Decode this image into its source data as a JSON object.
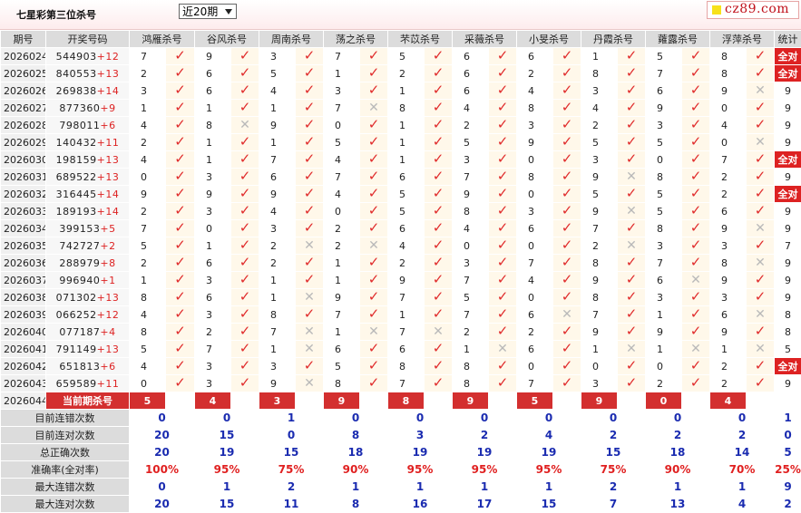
{
  "title": "七星彩第三位杀号",
  "select": "近20期",
  "logo": "cz89.com",
  "colors": {
    "accent": "#d32f2f",
    "check": "#e02b2b",
    "blue": "#1a2bb0"
  },
  "headers": [
    "期号",
    "开奖号码",
    "鸿雁杀号",
    "谷风杀号",
    "周南杀号",
    "荡之杀号",
    "芣苡杀号",
    "采薇杀号",
    "小旻杀号",
    "丹霞杀号",
    "蕹露杀号",
    "浮萍杀号",
    "统计"
  ],
  "rows": [
    {
      "p": "2026024",
      "n": "544903",
      "s": "+12",
      "k": [
        [
          "7",
          1
        ],
        [
          "9",
          1
        ],
        [
          "3",
          1
        ],
        [
          "7",
          1
        ],
        [
          "5",
          1
        ],
        [
          "6",
          1
        ],
        [
          "6",
          1
        ],
        [
          "1",
          1
        ],
        [
          "5",
          1
        ],
        [
          "8",
          1
        ]
      ],
      "t": "全对"
    },
    {
      "p": "2026025",
      "n": "840553",
      "s": "+13",
      "k": [
        [
          "2",
          1
        ],
        [
          "6",
          1
        ],
        [
          "5",
          1
        ],
        [
          "1",
          1
        ],
        [
          "2",
          1
        ],
        [
          "6",
          1
        ],
        [
          "2",
          1
        ],
        [
          "8",
          1
        ],
        [
          "7",
          1
        ],
        [
          "8",
          1
        ]
      ],
      "t": "全对"
    },
    {
      "p": "2026026",
      "n": "269838",
      "s": "+14",
      "k": [
        [
          "3",
          1
        ],
        [
          "6",
          1
        ],
        [
          "4",
          1
        ],
        [
          "3",
          1
        ],
        [
          "1",
          1
        ],
        [
          "6",
          1
        ],
        [
          "4",
          1
        ],
        [
          "3",
          1
        ],
        [
          "6",
          1
        ],
        [
          "9",
          0
        ]
      ],
      "t": "9"
    },
    {
      "p": "2026027",
      "n": "877360",
      "s": "+9",
      "k": [
        [
          "1",
          1
        ],
        [
          "1",
          1
        ],
        [
          "1",
          1
        ],
        [
          "7",
          0
        ],
        [
          "8",
          1
        ],
        [
          "4",
          1
        ],
        [
          "8",
          1
        ],
        [
          "4",
          1
        ],
        [
          "9",
          1
        ],
        [
          "0",
          1
        ]
      ],
      "t": "9"
    },
    {
      "p": "2026028",
      "n": "798011",
      "s": "+6",
      "k": [
        [
          "4",
          1
        ],
        [
          "8",
          0
        ],
        [
          "9",
          1
        ],
        [
          "0",
          1
        ],
        [
          "1",
          1
        ],
        [
          "2",
          1
        ],
        [
          "3",
          1
        ],
        [
          "2",
          1
        ],
        [
          "3",
          1
        ],
        [
          "4",
          1
        ]
      ],
      "t": "9"
    },
    {
      "p": "2026029",
      "n": "140432",
      "s": "+11",
      "k": [
        [
          "2",
          1
        ],
        [
          "1",
          1
        ],
        [
          "1",
          1
        ],
        [
          "5",
          1
        ],
        [
          "1",
          1
        ],
        [
          "5",
          1
        ],
        [
          "9",
          1
        ],
        [
          "5",
          1
        ],
        [
          "5",
          1
        ],
        [
          "0",
          0
        ]
      ],
      "t": "9"
    },
    {
      "p": "2026030",
      "n": "198159",
      "s": "+13",
      "k": [
        [
          "4",
          1
        ],
        [
          "1",
          1
        ],
        [
          "7",
          1
        ],
        [
          "4",
          1
        ],
        [
          "1",
          1
        ],
        [
          "3",
          1
        ],
        [
          "0",
          1
        ],
        [
          "3",
          1
        ],
        [
          "0",
          1
        ],
        [
          "7",
          1
        ]
      ],
      "t": "全对"
    },
    {
      "p": "2026031",
      "n": "689522",
      "s": "+13",
      "k": [
        [
          "0",
          1
        ],
        [
          "3",
          1
        ],
        [
          "6",
          1
        ],
        [
          "7",
          1
        ],
        [
          "6",
          1
        ],
        [
          "7",
          1
        ],
        [
          "8",
          1
        ],
        [
          "9",
          0
        ],
        [
          "8",
          1
        ],
        [
          "2",
          1
        ]
      ],
      "t": "9"
    },
    {
      "p": "2026032",
      "n": "316445",
      "s": "+14",
      "k": [
        [
          "9",
          1
        ],
        [
          "9",
          1
        ],
        [
          "9",
          1
        ],
        [
          "4",
          1
        ],
        [
          "5",
          1
        ],
        [
          "9",
          1
        ],
        [
          "0",
          1
        ],
        [
          "5",
          1
        ],
        [
          "5",
          1
        ],
        [
          "2",
          1
        ]
      ],
      "t": "全对"
    },
    {
      "p": "2026033",
      "n": "189193",
      "s": "+14",
      "k": [
        [
          "2",
          1
        ],
        [
          "3",
          1
        ],
        [
          "4",
          1
        ],
        [
          "0",
          1
        ],
        [
          "5",
          1
        ],
        [
          "8",
          1
        ],
        [
          "3",
          1
        ],
        [
          "9",
          0
        ],
        [
          "5",
          1
        ],
        [
          "6",
          1
        ]
      ],
      "t": "9"
    },
    {
      "p": "2026034",
      "n": "399153",
      "s": "+5",
      "k": [
        [
          "7",
          1
        ],
        [
          "0",
          1
        ],
        [
          "3",
          1
        ],
        [
          "2",
          1
        ],
        [
          "6",
          1
        ],
        [
          "4",
          1
        ],
        [
          "6",
          1
        ],
        [
          "7",
          1
        ],
        [
          "8",
          1
        ],
        [
          "9",
          0
        ]
      ],
      "t": "9"
    },
    {
      "p": "2026035",
      "n": "742727",
      "s": "+2",
      "k": [
        [
          "5",
          1
        ],
        [
          "1",
          1
        ],
        [
          "2",
          0
        ],
        [
          "2",
          0
        ],
        [
          "4",
          1
        ],
        [
          "0",
          1
        ],
        [
          "0",
          1
        ],
        [
          "2",
          0
        ],
        [
          "3",
          1
        ],
        [
          "3",
          1
        ]
      ],
      "t": "7"
    },
    {
      "p": "2026036",
      "n": "288979",
      "s": "+8",
      "k": [
        [
          "2",
          1
        ],
        [
          "6",
          1
        ],
        [
          "2",
          1
        ],
        [
          "1",
          1
        ],
        [
          "2",
          1
        ],
        [
          "3",
          1
        ],
        [
          "7",
          1
        ],
        [
          "8",
          1
        ],
        [
          "7",
          1
        ],
        [
          "8",
          0
        ]
      ],
      "t": "9"
    },
    {
      "p": "2026037",
      "n": "996940",
      "s": "+1",
      "k": [
        [
          "1",
          1
        ],
        [
          "3",
          1
        ],
        [
          "1",
          1
        ],
        [
          "1",
          1
        ],
        [
          "9",
          1
        ],
        [
          "7",
          1
        ],
        [
          "4",
          1
        ],
        [
          "9",
          1
        ],
        [
          "6",
          0
        ],
        [
          "9",
          1
        ]
      ],
      "t": "9"
    },
    {
      "p": "2026038",
      "n": "071302",
      "s": "+13",
      "k": [
        [
          "8",
          1
        ],
        [
          "6",
          1
        ],
        [
          "1",
          0
        ],
        [
          "9",
          1
        ],
        [
          "7",
          1
        ],
        [
          "5",
          1
        ],
        [
          "0",
          1
        ],
        [
          "8",
          1
        ],
        [
          "3",
          1
        ],
        [
          "3",
          1
        ]
      ],
      "t": "9"
    },
    {
      "p": "2026039",
      "n": "066252",
      "s": "+12",
      "k": [
        [
          "4",
          1
        ],
        [
          "3",
          1
        ],
        [
          "8",
          1
        ],
        [
          "7",
          1
        ],
        [
          "1",
          1
        ],
        [
          "7",
          1
        ],
        [
          "6",
          0
        ],
        [
          "7",
          1
        ],
        [
          "1",
          1
        ],
        [
          "6",
          0
        ]
      ],
      "t": "8"
    },
    {
      "p": "2026040",
      "n": "077187",
      "s": "+4",
      "k": [
        [
          "8",
          1
        ],
        [
          "2",
          1
        ],
        [
          "7",
          0
        ],
        [
          "1",
          0
        ],
        [
          "7",
          0
        ],
        [
          "2",
          1
        ],
        [
          "2",
          1
        ],
        [
          "9",
          1
        ],
        [
          "9",
          1
        ],
        [
          "9",
          1
        ]
      ],
      "t": "8"
    },
    {
      "p": "2026041",
      "n": "791149",
      "s": "+13",
      "k": [
        [
          "5",
          1
        ],
        [
          "7",
          1
        ],
        [
          "1",
          0
        ],
        [
          "6",
          1
        ],
        [
          "6",
          1
        ],
        [
          "1",
          0
        ],
        [
          "6",
          1
        ],
        [
          "1",
          0
        ],
        [
          "1",
          0
        ],
        [
          "1",
          0
        ]
      ],
      "t": "5"
    },
    {
      "p": "2026042",
      "n": "651813",
      "s": "+6",
      "k": [
        [
          "4",
          1
        ],
        [
          "3",
          1
        ],
        [
          "3",
          1
        ],
        [
          "5",
          1
        ],
        [
          "8",
          1
        ],
        [
          "8",
          1
        ],
        [
          "0",
          1
        ],
        [
          "0",
          1
        ],
        [
          "0",
          1
        ],
        [
          "2",
          1
        ]
      ],
      "t": "全对"
    },
    {
      "p": "2026043",
      "n": "659589",
      "s": "+11",
      "k": [
        [
          "0",
          1
        ],
        [
          "3",
          1
        ],
        [
          "9",
          0
        ],
        [
          "8",
          1
        ],
        [
          "7",
          1
        ],
        [
          "8",
          1
        ],
        [
          "7",
          1
        ],
        [
          "3",
          1
        ],
        [
          "2",
          1
        ],
        [
          "2",
          1
        ]
      ],
      "t": "9"
    }
  ],
  "current": {
    "p": "2026044",
    "label": "当前期杀号",
    "vals": [
      "5",
      "4",
      "3",
      "9",
      "8",
      "9",
      "5",
      "9",
      "0",
      "4"
    ]
  },
  "summary": [
    {
      "label": "目前连错次数",
      "vals": [
        "0",
        "0",
        "1",
        "0",
        "0",
        "0",
        "0",
        "0",
        "0",
        "0",
        "1"
      ]
    },
    {
      "label": "目前连对次数",
      "vals": [
        "20",
        "15",
        "0",
        "8",
        "3",
        "2",
        "4",
        "2",
        "2",
        "2",
        "0"
      ]
    },
    {
      "label": "总正确次数",
      "vals": [
        "20",
        "19",
        "15",
        "18",
        "19",
        "19",
        "19",
        "15",
        "18",
        "14",
        "5"
      ]
    },
    {
      "label": "准确率(全对率)",
      "vals": [
        "100%",
        "95%",
        "75%",
        "90%",
        "95%",
        "95%",
        "95%",
        "75%",
        "90%",
        "70%",
        "25%"
      ],
      "red": true
    },
    {
      "label": "最大连错次数",
      "vals": [
        "0",
        "1",
        "2",
        "1",
        "1",
        "1",
        "1",
        "2",
        "1",
        "1",
        "9"
      ]
    },
    {
      "label": "最大连对次数",
      "vals": [
        "20",
        "15",
        "11",
        "8",
        "16",
        "17",
        "15",
        "7",
        "13",
        "4",
        "2"
      ]
    }
  ]
}
